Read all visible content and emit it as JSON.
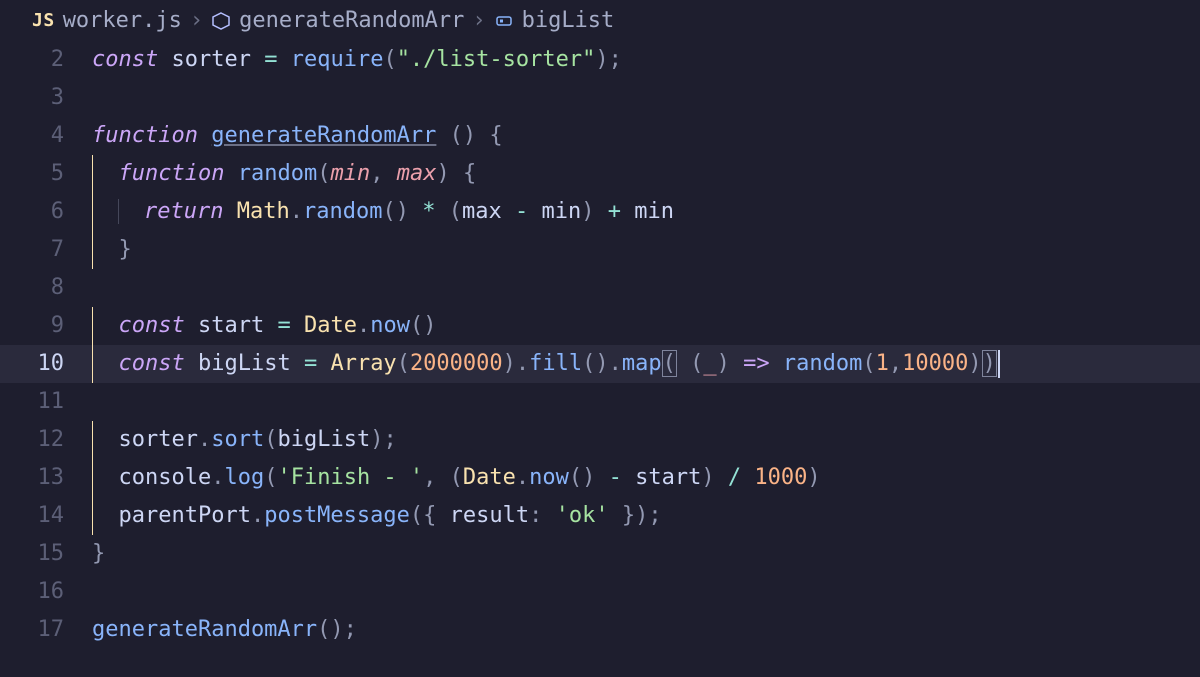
{
  "breadcrumb": {
    "jsBadge": "JS",
    "file": "worker.js",
    "fn": "generateRandomArr",
    "var": "bigList"
  },
  "lines": {
    "l2": {
      "num": "2"
    },
    "l3": {
      "num": "3"
    },
    "l4": {
      "num": "4"
    },
    "l5": {
      "num": "5"
    },
    "l6": {
      "num": "6"
    },
    "l7": {
      "num": "7"
    },
    "l8": {
      "num": "8"
    },
    "l9": {
      "num": "9"
    },
    "l10": {
      "num": "10"
    },
    "l11": {
      "num": "11"
    },
    "l12": {
      "num": "12"
    },
    "l13": {
      "num": "13"
    },
    "l14": {
      "num": "14"
    },
    "l15": {
      "num": "15"
    },
    "l16": {
      "num": "16"
    },
    "l17": {
      "num": "17"
    }
  },
  "tok": {
    "const": "const",
    "function": "function",
    "return": "return",
    "sorter": "sorter",
    "require": "require",
    "listSorterStr": "\"./list-sorter\"",
    "generateRandomArr": "generateRandomArr",
    "random": "random",
    "min": "min",
    "max": "max",
    "Math": "Math",
    "randomCall": "random",
    "start": "start",
    "Date": "Date",
    "now": "now",
    "bigList": "bigList",
    "Array": "Array",
    "n2000000": "2000000",
    "fill": "fill",
    "map": "map",
    "underscore": "_",
    "arrow": "=>",
    "n1": "1",
    "n10000": "10000",
    "sort": "sort",
    "console": "console",
    "log": "log",
    "finishStr": "'Finish - '",
    "n1000": "1000",
    "parentPort": "parentPort",
    "postMessage": "postMessage",
    "result": "result",
    "okStr": "'ok'"
  }
}
